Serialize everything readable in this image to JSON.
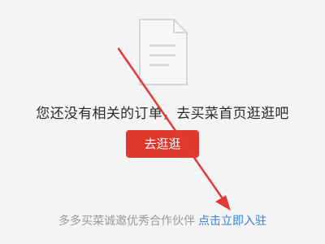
{
  "empty_state": {
    "illustration_icon": "document-icon",
    "message": "您还没有相关的订单，去买菜首页逛逛吧",
    "button_label": "去逛逛"
  },
  "footer": {
    "invite_text": "多多买菜诚邀优秀合作伙伴",
    "join_link_label": "点击立即入驻"
  },
  "colors": {
    "background": "#f4f4f4",
    "primary_button": "#e0392b",
    "link": "#3a7bd5",
    "muted_text": "#9a9a9a",
    "annotation_arrow": "#e53935"
  }
}
